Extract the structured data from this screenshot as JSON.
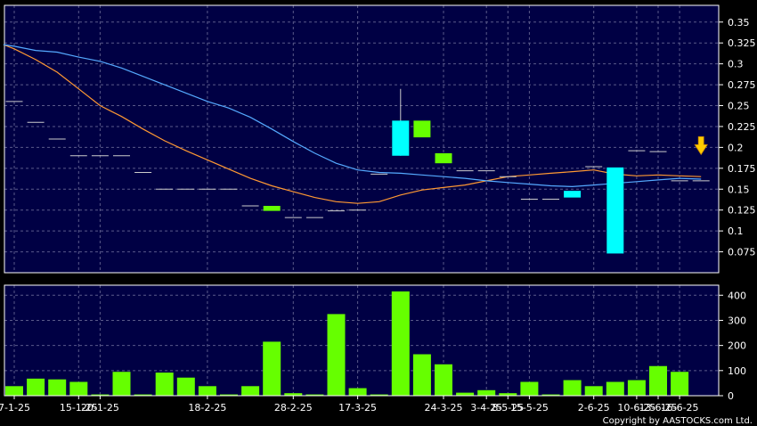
{
  "chart_data": [
    {
      "type": "candlestick",
      "panel": "price",
      "ylim": [
        0.05,
        0.37
      ],
      "yticks": [
        0.075,
        0.1,
        0.125,
        0.15,
        0.175,
        0.2,
        0.225,
        0.25,
        0.275,
        0.3,
        0.325,
        0.35
      ],
      "ytick_labels": [
        "0.075",
        "0.1",
        "0.125",
        "0.15",
        "0.175",
        "0.2",
        "0.225",
        "0.25",
        "0.275",
        "0.3",
        "0.325",
        "0.35"
      ],
      "grid": true,
      "bar_count": 33,
      "candles": [
        {
          "i": 0,
          "open": 0.255,
          "close": 0.255,
          "high": 0.255,
          "low": 0.255
        },
        {
          "i": 1,
          "open": 0.23,
          "close": 0.23,
          "high": 0.23,
          "low": 0.23
        },
        {
          "i": 2,
          "open": 0.21,
          "close": 0.21,
          "high": 0.21,
          "low": 0.21
        },
        {
          "i": 3,
          "open": 0.19,
          "close": 0.19,
          "high": 0.19,
          "low": 0.19
        },
        {
          "i": 4,
          "open": 0.19,
          "close": 0.19,
          "high": 0.19,
          "low": 0.19
        },
        {
          "i": 5,
          "open": 0.19,
          "close": 0.19,
          "high": 0.19,
          "low": 0.19
        },
        {
          "i": 6,
          "open": 0.17,
          "close": 0.17,
          "high": 0.17,
          "low": 0.17
        },
        {
          "i": 7,
          "open": 0.15,
          "close": 0.15,
          "high": 0.15,
          "low": 0.15
        },
        {
          "i": 8,
          "open": 0.15,
          "close": 0.15,
          "high": 0.15,
          "low": 0.15
        },
        {
          "i": 9,
          "open": 0.15,
          "close": 0.15,
          "high": 0.15,
          "low": 0.15
        },
        {
          "i": 10,
          "open": 0.15,
          "close": 0.15,
          "high": 0.15,
          "low": 0.15
        },
        {
          "i": 11,
          "open": 0.13,
          "close": 0.13,
          "high": 0.13,
          "low": 0.13
        },
        {
          "i": 12,
          "open": 0.13,
          "close": 0.124,
          "high": 0.13,
          "low": 0.124
        },
        {
          "i": 13,
          "open": 0.116,
          "close": 0.116,
          "high": 0.116,
          "low": 0.116
        },
        {
          "i": 14,
          "open": 0.116,
          "close": 0.116,
          "high": 0.116,
          "low": 0.116
        },
        {
          "i": 15,
          "open": 0.124,
          "close": 0.124,
          "high": 0.124,
          "low": 0.124
        },
        {
          "i": 16,
          "open": 0.125,
          "close": 0.125,
          "high": 0.125,
          "low": 0.125
        },
        {
          "i": 17,
          "open": 0.168,
          "close": 0.168,
          "high": 0.168,
          "low": 0.168
        },
        {
          "i": 18,
          "open": 0.19,
          "close": 0.232,
          "high": 0.27,
          "low": 0.19
        },
        {
          "i": 19,
          "open": 0.232,
          "close": 0.212,
          "high": 0.232,
          "low": 0.212
        },
        {
          "i": 20,
          "open": 0.193,
          "close": 0.181,
          "high": 0.193,
          "low": 0.181
        },
        {
          "i": 21,
          "open": 0.172,
          "close": 0.172,
          "high": 0.172,
          "low": 0.172
        },
        {
          "i": 22,
          "open": 0.172,
          "close": 0.172,
          "high": 0.172,
          "low": 0.172
        },
        {
          "i": 23,
          "open": 0.165,
          "close": 0.165,
          "high": 0.165,
          "low": 0.165
        },
        {
          "i": 24,
          "open": 0.138,
          "close": 0.138,
          "high": 0.138,
          "low": 0.138
        },
        {
          "i": 25,
          "open": 0.138,
          "close": 0.138,
          "high": 0.138,
          "low": 0.138
        },
        {
          "i": 26,
          "open": 0.14,
          "close": 0.148,
          "high": 0.148,
          "low": 0.14
        },
        {
          "i": 27,
          "open": 0.177,
          "close": 0.177,
          "high": 0.177,
          "low": 0.177
        },
        {
          "i": 28,
          "open": 0.073,
          "close": 0.176,
          "high": 0.176,
          "low": 0.073
        },
        {
          "i": 29,
          "open": 0.196,
          "close": 0.196,
          "high": 0.196,
          "low": 0.196
        },
        {
          "i": 30,
          "open": 0.195,
          "close": 0.195,
          "high": 0.195,
          "low": 0.195
        },
        {
          "i": 31,
          "open": 0.16,
          "close": 0.16,
          "high": 0.16,
          "low": 0.16
        },
        {
          "i": 32,
          "open": 0.16,
          "close": 0.16,
          "high": 0.16,
          "low": 0.16
        }
      ],
      "series": [
        {
          "color": "#ff9933",
          "points": [
            [
              -0.5,
              0.323
            ],
            [
              0,
              0.318
            ],
            [
              1,
              0.305
            ],
            [
              2,
              0.29
            ],
            [
              3,
              0.27
            ],
            [
              4,
              0.25
            ],
            [
              5,
              0.237
            ],
            [
              6,
              0.222
            ],
            [
              7,
              0.208
            ],
            [
              8,
              0.196
            ],
            [
              9,
              0.185
            ],
            [
              10,
              0.174
            ],
            [
              11,
              0.163
            ],
            [
              12,
              0.154
            ],
            [
              13,
              0.147
            ],
            [
              14,
              0.14
            ],
            [
              15,
              0.135
            ],
            [
              16,
              0.133
            ],
            [
              17,
              0.135
            ],
            [
              18,
              0.143
            ],
            [
              19,
              0.149
            ],
            [
              20,
              0.152
            ],
            [
              21,
              0.155
            ],
            [
              22,
              0.16
            ],
            [
              23,
              0.165
            ],
            [
              24,
              0.167
            ],
            [
              25,
              0.169
            ],
            [
              26,
              0.171
            ],
            [
              27,
              0.173
            ],
            [
              28,
              0.168
            ],
            [
              29,
              0.166
            ],
            [
              30,
              0.167
            ],
            [
              31,
              0.166
            ],
            [
              32,
              0.165
            ]
          ]
        },
        {
          "color": "#55aaff",
          "points": [
            [
              -0.5,
              0.323
            ],
            [
              0,
              0.321
            ],
            [
              1,
              0.316
            ],
            [
              2,
              0.314
            ],
            [
              3,
              0.308
            ],
            [
              4,
              0.303
            ],
            [
              5,
              0.295
            ],
            [
              6,
              0.285
            ],
            [
              7,
              0.275
            ],
            [
              8,
              0.265
            ],
            [
              9,
              0.255
            ],
            [
              10,
              0.247
            ],
            [
              11,
              0.236
            ],
            [
              12,
              0.222
            ],
            [
              13,
              0.207
            ],
            [
              14,
              0.193
            ],
            [
              15,
              0.181
            ],
            [
              16,
              0.173
            ],
            [
              17,
              0.17
            ],
            [
              18,
              0.169
            ],
            [
              19,
              0.167
            ],
            [
              20,
              0.165
            ],
            [
              21,
              0.163
            ],
            [
              22,
              0.16
            ],
            [
              23,
              0.158
            ],
            [
              24,
              0.156
            ],
            [
              25,
              0.154
            ],
            [
              26,
              0.153
            ],
            [
              27,
              0.155
            ],
            [
              28,
              0.157
            ],
            [
              29,
              0.159
            ],
            [
              30,
              0.161
            ],
            [
              31,
              0.163
            ],
            [
              32,
              0.162
            ]
          ]
        }
      ],
      "arrow_marker": {
        "i": 32,
        "value": 0.2,
        "color": "#ffcc00",
        "icon": "down-arrow-icon"
      }
    },
    {
      "type": "bar",
      "panel": "volume",
      "ylim": [
        0,
        440
      ],
      "yticks": [
        0,
        100,
        200,
        300,
        400
      ],
      "ytick_labels": [
        "0",
        "100",
        "200",
        "300",
        "400"
      ],
      "grid": true,
      "values": [
        38,
        68,
        65,
        55,
        5,
        95,
        5,
        92,
        72,
        38,
        5,
        38,
        215,
        10,
        5,
        325,
        30,
        5,
        415,
        165,
        125,
        12,
        22,
        10,
        55,
        5,
        62,
        38,
        55,
        62,
        118,
        95
      ],
      "color": "#66ff00"
    }
  ],
  "x_labels": [
    {
      "i": 0,
      "text": "7-1-25"
    },
    {
      "i": 3,
      "text": "15-1-25"
    },
    {
      "i": 4,
      "text": "20-1-25"
    },
    {
      "i": 9,
      "text": "18-2-25"
    },
    {
      "i": 13,
      "text": "28-2-25"
    },
    {
      "i": 16,
      "text": "17-3-25"
    },
    {
      "i": 20,
      "text": "24-3-25"
    },
    {
      "i": 22,
      "text": "3-4-25"
    },
    {
      "i": 23,
      "text": "8-5-25"
    },
    {
      "i": 24,
      "text": "15-5-25"
    },
    {
      "i": 27,
      "text": "2-6-25"
    },
    {
      "i": 29,
      "text": "10-6-25"
    },
    {
      "i": 30,
      "text": "13-6-25"
    },
    {
      "i": 31,
      "text": "16-6-25"
    }
  ],
  "colors": {
    "panel_bg": "#000044",
    "page_bg": "#000000",
    "grid": "#5a5a8a",
    "up_candle": "#00ffff",
    "down_candle": "#66ff00",
    "doji": "#ffffff"
  },
  "copyright": "Copyright by AASTOCKS.com Ltd."
}
